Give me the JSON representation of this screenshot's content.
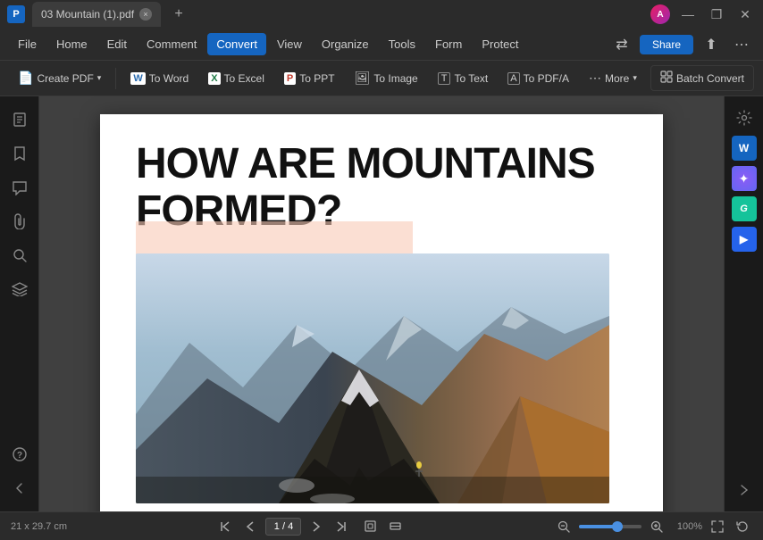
{
  "titlebar": {
    "logo": "P",
    "tab": {
      "label": "03 Mountain (1).pdf",
      "close": "×"
    },
    "add_tab": "+",
    "avatar": "A",
    "win_btns": {
      "minimize": "—",
      "restore": "❐",
      "close": "✕"
    }
  },
  "menubar": {
    "items": [
      "File",
      "Home",
      "Edit",
      "Comment",
      "Convert",
      "View",
      "Organize",
      "Tools",
      "Form",
      "Protect"
    ],
    "active_item": "Convert",
    "right": {
      "share": "Share",
      "icons": [
        "⇄",
        "⬆",
        "⋯"
      ]
    }
  },
  "toolbar": {
    "buttons": [
      {
        "id": "create-pdf",
        "icon": "📄",
        "label": "Create PDF",
        "has_arrow": true
      },
      {
        "id": "to-word",
        "icon": "W",
        "label": "To Word"
      },
      {
        "id": "to-excel",
        "icon": "X",
        "label": "To Excel"
      },
      {
        "id": "to-ppt",
        "icon": "P",
        "label": "To PPT"
      },
      {
        "id": "to-image",
        "icon": "🖼",
        "label": "To Image"
      },
      {
        "id": "to-text",
        "icon": "T",
        "label": "To Text"
      },
      {
        "id": "to-pdfa",
        "icon": "A",
        "label": "To PDF/A"
      },
      {
        "id": "more",
        "icon": "⋯",
        "label": "More",
        "has_arrow": true
      }
    ],
    "batch": {
      "icon": "⚙",
      "label": "Batch Convert"
    }
  },
  "document": {
    "title": "HOW ARE MOUNTAINS FORMED?",
    "page_info": "1 / 4",
    "size": "21 x 29.7 cm"
  },
  "sidebar_left": {
    "icons": [
      "📄",
      "🔖",
      "💬",
      "📎",
      "🔍",
      "⊕"
    ]
  },
  "sidebar_right": {
    "icons": [
      {
        "id": "settings",
        "char": "≡",
        "type": "settings"
      },
      {
        "id": "word",
        "char": "W",
        "type": "word"
      },
      {
        "id": "gemini",
        "char": "✦",
        "type": "gemini"
      },
      {
        "id": "grammarly",
        "char": "G",
        "type": "grammarly"
      },
      {
        "id": "arrow",
        "char": "►",
        "type": "blue-arrow"
      }
    ]
  },
  "statusbar": {
    "size": "21 x 29.7 cm",
    "page_current": "1",
    "page_total": "4",
    "zoom": "100%",
    "zoom_level": 55
  }
}
